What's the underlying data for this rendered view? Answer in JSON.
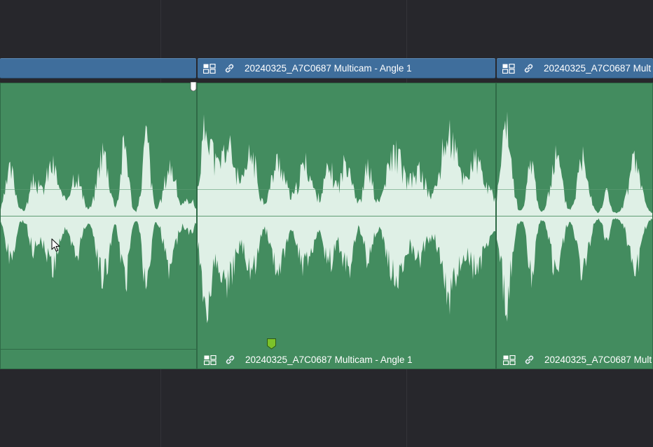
{
  "timeline": {
    "clips": [
      {
        "video_title": "",
        "audio_title": ""
      },
      {
        "video_title": "20240325_A7C0687 Multicam - Angle 1",
        "audio_title": "20240325_A7C0687 Multicam - Angle 1"
      },
      {
        "video_title": "20240325_A7C0687 Mult",
        "audio_title": "20240325_A7C0687 Mult"
      }
    ],
    "icons": {
      "multicam": "multicam-icon",
      "link": "link-icon"
    },
    "colors": {
      "background": "#27272c",
      "video_track": "#3f6e9c",
      "audio_track": "#438c5f",
      "waveform": "#dff0e6",
      "marker": "#7cc22a"
    }
  }
}
